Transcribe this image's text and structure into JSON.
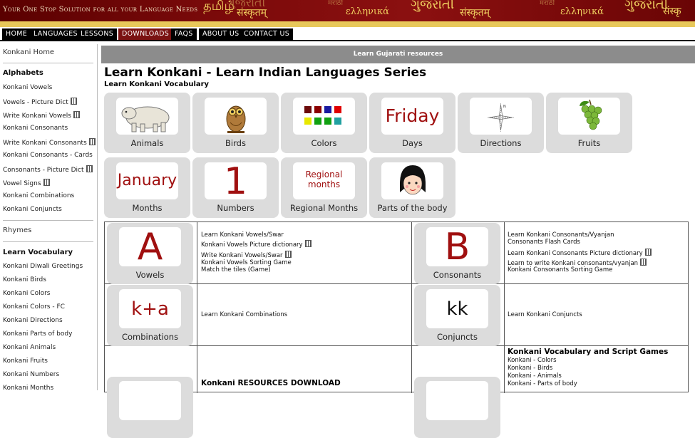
{
  "banner": {
    "tagline": "Your One Stop Solution for all your Language Needs",
    "scripts": [
      "தமிழ்",
      "ગુજરાતી",
      "संस्कृतम्",
      "मराठी",
      "ελληνικά",
      "ગુજરાતી",
      "संस्कृतम्",
      "मराठी",
      "ελληνικά",
      "ગુજરાતી",
      "संस्कृ"
    ]
  },
  "nav": {
    "items": [
      "HOME",
      "LANGUAGES",
      "LESSONS",
      "DOWNLOADS",
      "FAQS",
      "ABOUT US",
      "CONTACT US"
    ],
    "active": "DOWNLOADS"
  },
  "sidebar": {
    "home": "Konkani Home",
    "alphabets_head": "Alphabets",
    "alphabets": [
      "Konkani Vowels",
      "Vowels - Picture Dict",
      "Write Konkani Vowels",
      "Konkani Consonants",
      "Write Konkani Consonants",
      "Konkani Consonants - Cards",
      "Consonants - Picture Dict",
      "Vowel Signs",
      "Konkani Combinations",
      "Konkani Conjuncts"
    ],
    "rhymes": "Rhymes",
    "vocab_head": "Learn Vocabulary",
    "vocab": [
      "Konkani Diwali Greetings",
      "Konkani Birds",
      "Konkani Colors",
      "Konkani Colors - FC",
      "Konkani Directions",
      "Konkani Parts of body",
      "Konkani Animals",
      "Konkani Fruits",
      "Konkani Numbers",
      "Konkani Months"
    ]
  },
  "main": {
    "header": "Learn Gujarati resources",
    "title": "Learn Konkani - Learn Indian Languages Series",
    "subtitle": "Learn Konkani Vocabulary",
    "tiles": [
      {
        "label": "Animals"
      },
      {
        "label": "Birds"
      },
      {
        "label": "Colors"
      },
      {
        "label": "Days",
        "pic_text": "Friday"
      },
      {
        "label": "Directions"
      },
      {
        "label": "Fruits"
      },
      {
        "label": "Months",
        "pic_text": "January"
      },
      {
        "label": "Numbers",
        "pic_text": "1"
      },
      {
        "label": "Regional Months",
        "pic_text": "Regional months"
      },
      {
        "label": "Parts of the body"
      }
    ],
    "color_swatches": [
      "#6b0a0a",
      "#8b0000",
      "#1a1aa0",
      "#e00000",
      "#e8e800",
      "#10a010",
      "#10a010",
      "#20a0a0"
    ],
    "directions_letter": "N"
  },
  "table": {
    "vowels": {
      "label": "Vowels",
      "pic_text": "A",
      "links": [
        "Learn Konkani Vowels/Swar",
        "Konkani Vowels Picture dictionary",
        "Write Konkani Vowels/Swar",
        "Konkani Vowels Sorting Game",
        "Match the tiles (Game)"
      ]
    },
    "consonants": {
      "label": "Consonants",
      "pic_text": "B",
      "links": [
        "Learn Konkani Consonants/Vyanjan",
        "Consonants Flash Cards",
        "Learn Konkani Consonants Picture dictionary",
        "Learn to write Konkani consonants/vyanjan",
        "Konkani Consonants Sorting Game"
      ]
    },
    "combinations": {
      "label": "Combinations",
      "pic_text": "k+a",
      "link": "Learn Konkani Combinations"
    },
    "conjuncts": {
      "label": "Conjuncts",
      "pic_text": "kk",
      "link": "Learn Konkani Conjuncts"
    },
    "resources": {
      "title": "Konkani RESOURCES DOWNLOAD"
    },
    "games": {
      "title": "Konkani Vocabulary and Script Games",
      "links": [
        "Konkani - Colors",
        "Konkani - Birds",
        "Konkani - Animals",
        "Konkani - Parts of body"
      ]
    }
  }
}
